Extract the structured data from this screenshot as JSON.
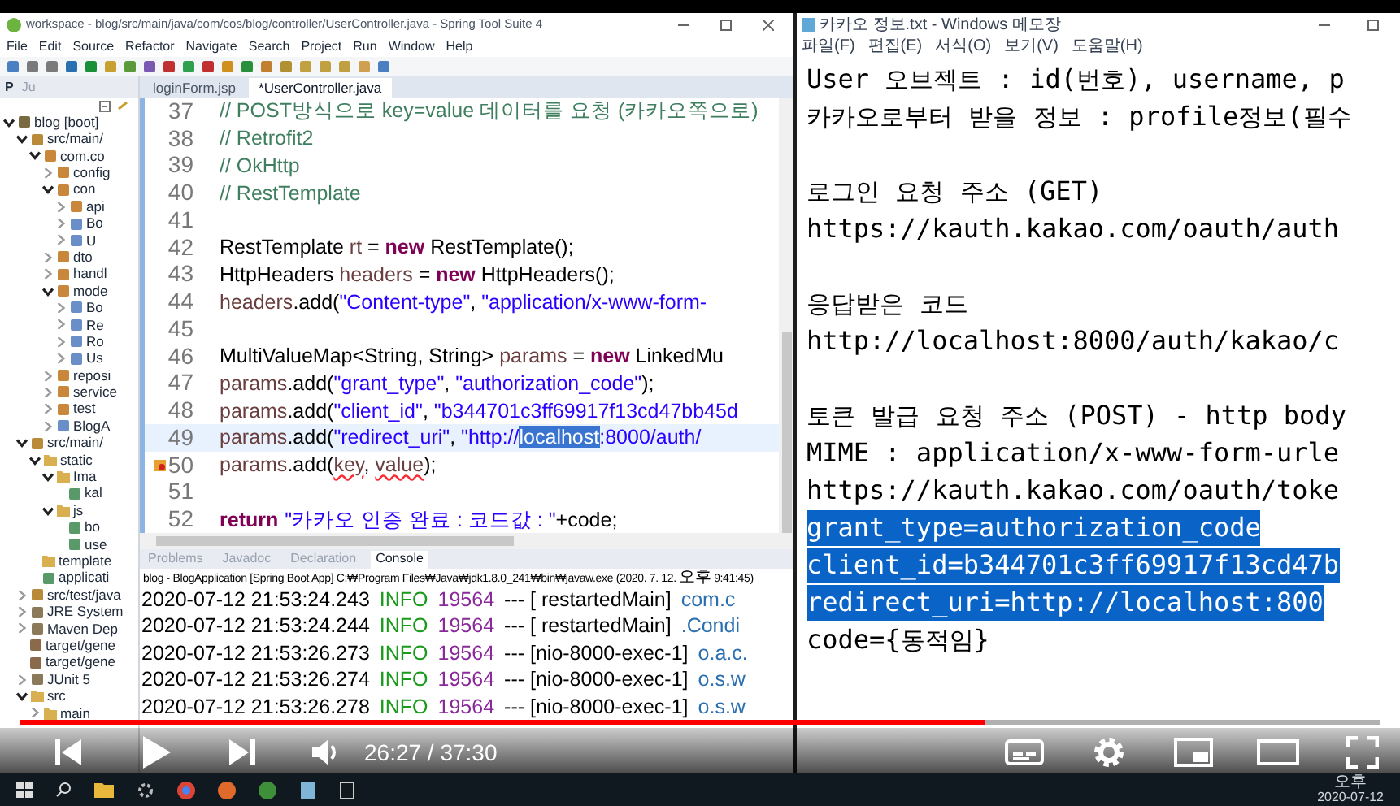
{
  "eclipse": {
    "title": "workspace - blog/src/main/java/com/cos/blog/controller/UserController.java - Spring Tool Suite 4",
    "menu": [
      "File",
      "Edit",
      "Source",
      "Refactor",
      "Navigate",
      "Search",
      "Project",
      "Run",
      "Window",
      "Help"
    ],
    "view_tabs": [
      {
        "label": "P",
        "selected": true
      },
      {
        "label": "Ju",
        "selected": false
      }
    ],
    "tree": [
      {
        "label": "blog [boot]",
        "kind": "project",
        "children": [
          {
            "label": "src/main/",
            "kind": "source",
            "children": [
              {
                "label": "com.co",
                "kind": "package",
                "children": [
                  {
                    "label": "config",
                    "kind": "package"
                  },
                  {
                    "label": "con",
                    "kind": "package",
                    "children": [
                      {
                        "label": "api",
                        "kind": "package"
                      },
                      {
                        "label": "Bo",
                        "kind": "class"
                      },
                      {
                        "label": "U",
                        "kind": "class"
                      }
                    ]
                  },
                  {
                    "label": "dto",
                    "kind": "package"
                  },
                  {
                    "label": "handl",
                    "kind": "package"
                  },
                  {
                    "label": "mode",
                    "kind": "package",
                    "children": [
                      {
                        "label": "Bo",
                        "kind": "class"
                      },
                      {
                        "label": "Re",
                        "kind": "class"
                      },
                      {
                        "label": "Ro",
                        "kind": "class"
                      },
                      {
                        "label": "Us",
                        "kind": "class"
                      }
                    ]
                  },
                  {
                    "label": "reposi",
                    "kind": "package"
                  },
                  {
                    "label": "service",
                    "kind": "package"
                  },
                  {
                    "label": "test",
                    "kind": "package"
                  },
                  {
                    "label": "BlogA",
                    "kind": "class"
                  }
                ]
              }
            ]
          },
          {
            "label": "src/main/",
            "kind": "source",
            "children": [
              {
                "label": "static",
                "kind": "folder",
                "children": [
                  {
                    "label": "Ima",
                    "kind": "folder",
                    "children": [
                      {
                        "label": "kal",
                        "kind": "file"
                      }
                    ]
                  },
                  {
                    "label": "js",
                    "kind": "folder",
                    "children": [
                      {
                        "label": "bo",
                        "kind": "file"
                      },
                      {
                        "label": "use",
                        "kind": "file"
                      }
                    ]
                  }
                ]
              },
              {
                "label": "template",
                "kind": "folderleaf"
              },
              {
                "label": "applicati",
                "kind": "file"
              }
            ]
          },
          {
            "label": "src/test/java",
            "kind": "source"
          },
          {
            "label": "JRE System",
            "kind": "library"
          },
          {
            "label": "Maven Dep",
            "kind": "library"
          },
          {
            "label": "target/gene",
            "kind": "sourceleaf"
          },
          {
            "label": "target/gene",
            "kind": "sourceleaf"
          },
          {
            "label": "JUnit 5",
            "kind": "library"
          },
          {
            "label": "src",
            "kind": "folder",
            "children": [
              {
                "label": "main",
                "kind": "folder"
              }
            ]
          }
        ]
      }
    ],
    "editor_tabs": [
      {
        "label": "loginForm.jsp",
        "selected": false
      },
      {
        "label": "*UserController.java",
        "selected": true
      }
    ],
    "code": [
      {
        "number": "37",
        "current": false,
        "error": false,
        "segments": [
          {
            "kind": "comment",
            "text": "// POST방식으로 key=value 데이터를 요청 (카카오쪽으로)"
          }
        ]
      },
      {
        "number": "38",
        "current": false,
        "error": false,
        "segments": [
          {
            "kind": "comment",
            "text": "// Retrofit2"
          }
        ]
      },
      {
        "number": "39",
        "current": false,
        "error": false,
        "segments": [
          {
            "kind": "comment",
            "text": "// OkHttp"
          }
        ]
      },
      {
        "number": "40",
        "current": false,
        "error": false,
        "segments": [
          {
            "kind": "comment",
            "text": "// RestTemplate"
          }
        ]
      },
      {
        "number": "41",
        "current": false,
        "error": false
      },
      {
        "number": "42",
        "current": false,
        "error": false,
        "segments": [
          {
            "kind": "plain",
            "text": "RestTemplate "
          },
          {
            "kind": "local",
            "text": "rt"
          },
          {
            "kind": "plain",
            "text": " = "
          },
          {
            "kind": "keyword",
            "text": "new"
          },
          {
            "kind": "plain",
            "text": " RestTemplate();"
          }
        ]
      },
      {
        "number": "43",
        "current": false,
        "error": false,
        "segments": [
          {
            "kind": "plain",
            "text": "HttpHeaders "
          },
          {
            "kind": "local",
            "text": "headers"
          },
          {
            "kind": "plain",
            "text": " = "
          },
          {
            "kind": "keyword",
            "text": "new"
          },
          {
            "kind": "plain",
            "text": " HttpHeaders();"
          }
        ]
      },
      {
        "number": "44",
        "current": false,
        "error": false,
        "segments": [
          {
            "kind": "local",
            "text": "headers"
          },
          {
            "kind": "plain",
            "text": ".add("
          },
          {
            "kind": "string",
            "text": "\"Content-type\""
          },
          {
            "kind": "plain",
            "text": ", "
          },
          {
            "kind": "string",
            "text": "\"application/x-www-form-"
          }
        ]
      },
      {
        "number": "45",
        "current": false,
        "error": false
      },
      {
        "number": "46",
        "current": false,
        "error": false,
        "segments": [
          {
            "kind": "plain",
            "text": "MultiValueMap<String, String> "
          },
          {
            "kind": "local",
            "text": "params"
          },
          {
            "kind": "plain",
            "text": " = "
          },
          {
            "kind": "keyword",
            "text": "new"
          },
          {
            "kind": "plain",
            "text": " LinkedMu"
          }
        ]
      },
      {
        "number": "47",
        "current": false,
        "error": false,
        "segments": [
          {
            "kind": "local",
            "text": "params"
          },
          {
            "kind": "plain",
            "text": ".add("
          },
          {
            "kind": "string",
            "text": "\"grant_type\""
          },
          {
            "kind": "plain",
            "text": ", "
          },
          {
            "kind": "string",
            "text": "\"authorization_code\""
          },
          {
            "kind": "plain",
            "text": ");"
          }
        ]
      },
      {
        "number": "48",
        "current": false,
        "error": false,
        "segments": [
          {
            "kind": "local",
            "text": "params"
          },
          {
            "kind": "plain",
            "text": ".add("
          },
          {
            "kind": "string",
            "text": "\"client_id\""
          },
          {
            "kind": "plain",
            "text": ", "
          },
          {
            "kind": "string",
            "text": "\"b344701c3ff69917f13cd47bb45d"
          }
        ]
      },
      {
        "number": "49",
        "current": true,
        "error": false,
        "segments": [
          {
            "kind": "local",
            "text": "params"
          },
          {
            "kind": "plain",
            "text": ".add("
          },
          {
            "kind": "string",
            "text": "\"redirect_uri\""
          },
          {
            "kind": "plain",
            "text": ", "
          },
          {
            "kind": "string",
            "text": "\"http://"
          },
          {
            "kind": "selected",
            "text": "localhost"
          },
          {
            "kind": "string",
            "text": ":8000/auth/"
          }
        ]
      },
      {
        "number": "50",
        "current": false,
        "error": true,
        "segments": [
          {
            "kind": "local",
            "text": "params"
          },
          {
            "kind": "plain",
            "text": ".add("
          },
          {
            "kind": "misspelled",
            "text": "key"
          },
          {
            "kind": "plain",
            "text": ", "
          },
          {
            "kind": "misspelled",
            "text": "value"
          },
          {
            "kind": "plain",
            "text": ");"
          }
        ]
      },
      {
        "number": "51",
        "current": false,
        "error": false
      },
      {
        "number": "52",
        "current": false,
        "error": false,
        "segments": [
          {
            "kind": "keyword",
            "text": "return"
          },
          {
            "kind": "string",
            "text": "\"카카오 인증 완료 : 코드값 : \""
          },
          {
            "kind": "plain",
            "text": "+code;"
          }
        ]
      }
    ],
    "console": {
      "tabs": [
        {
          "label": "Problems",
          "selected": false
        },
        {
          "label": "Javadoc",
          "selected": false
        },
        {
          "label": "Declaration",
          "selected": false
        },
        {
          "label": "Console",
          "selected": true
        }
      ],
      "header": "blog - BlogApplication [Spring Boot App] C:₩Program Files₩Java₩jdk1.8.0_241₩bin₩javaw.exe  (2020. 7. 12. 오후 9:41:45)",
      "rows": [
        {
          "time": "2020-07-12 21:53:24.243",
          "level": "INFO",
          "pid": "19564",
          "thread": "--- [  restartedMain]",
          "logger": "com.c"
        },
        {
          "time": "2020-07-12 21:53:24.244",
          "level": "INFO",
          "pid": "19564",
          "thread": "--- [  restartedMain]",
          "logger": ".Condi"
        },
        {
          "time": "2020-07-12 21:53:26.273",
          "level": "INFO",
          "pid": "19564",
          "thread": "--- [nio-8000-exec-1]",
          "logger": "o.a.c."
        },
        {
          "time": "2020-07-12 21:53:26.274",
          "level": "INFO",
          "pid": "19564",
          "thread": "--- [nio-8000-exec-1]",
          "logger": "o.s.w"
        },
        {
          "time": "2020-07-12 21:53:26.278",
          "level": "INFO",
          "pid": "19564",
          "thread": "--- [nio-8000-exec-1]",
          "logger": "o.s.w"
        }
      ]
    }
  },
  "notepad": {
    "title": "카카오 정보.txt - Windows 메모장",
    "menu": [
      "파일(F)",
      "편집(E)",
      "서식(O)",
      "보기(V)",
      "도움말(H)"
    ],
    "lines": [
      {
        "text": "User 오브젝트 : id(번호), username, p",
        "selected": false
      },
      {
        "text": "카카오로부터 받을 정보 : profile정보(필수",
        "selected": false
      },
      {
        "selected": false
      },
      {
        "text": "로그인 요청 주소 (GET)",
        "selected": false
      },
      {
        "text": "https://kauth.kakao.com/oauth/auth",
        "selected": false
      },
      {
        "selected": false
      },
      {
        "text": "응답받은 코드",
        "selected": false
      },
      {
        "text": "http://localhost:8000/auth/kakao/c",
        "selected": false
      },
      {
        "selected": false
      },
      {
        "text": "토큰 발급 요청 주소 (POST) - http body",
        "selected": false
      },
      {
        "text": "MIME : application/x-www-form-urle",
        "selected": false
      },
      {
        "text": "https://kauth.kakao.com/oauth/toke",
        "selected": false
      },
      {
        "text": "grant_type=authorization_code",
        "selected": true
      },
      {
        "text": "client_id=b344701c3ff69917f13cd47b",
        "selected": true
      },
      {
        "text": "redirect_uri=http://localhost:800",
        "selected": true
      },
      {
        "text": "code={동적임}",
        "selected": false
      }
    ]
  },
  "player": {
    "progress": {
      "level": 0.71
    },
    "time": "26:27 / 37:30"
  },
  "taskbar": {
    "clock": [
      "오후",
      "2020-07-12"
    ]
  }
}
